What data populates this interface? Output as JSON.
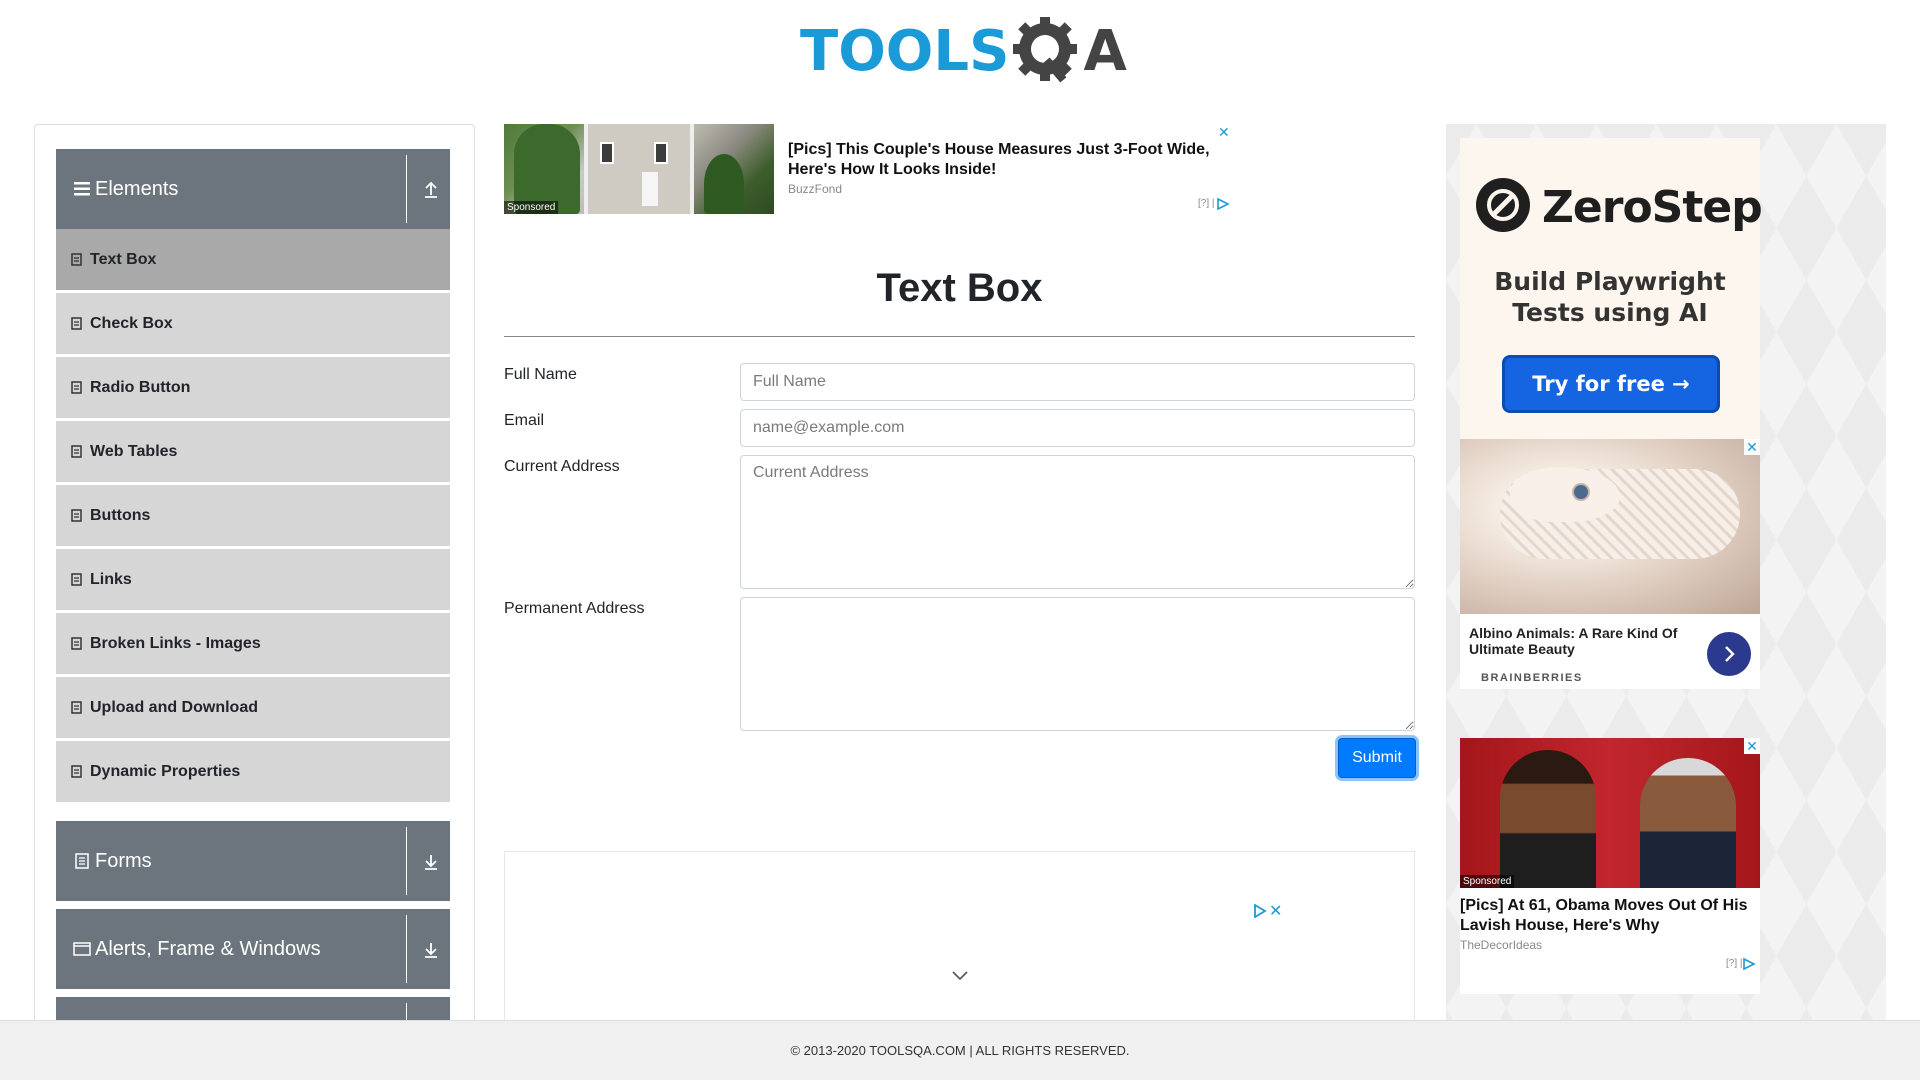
{
  "header": {
    "logo_text_left": "TOOLS",
    "logo_text_right": "A"
  },
  "sidebar": {
    "groups": [
      {
        "label": "Elements",
        "icon": "hamburger-icon",
        "arrow": "collapse-up-icon"
      },
      {
        "label": "Forms",
        "icon": "document-icon",
        "arrow": "expand-down-icon"
      },
      {
        "label": "Alerts, Frame & Windows",
        "icon": "window-icon",
        "arrow": "expand-down-icon"
      }
    ],
    "items": [
      {
        "label": "Text Box",
        "active": true
      },
      {
        "label": "Check Box"
      },
      {
        "label": "Radio Button"
      },
      {
        "label": "Web Tables"
      },
      {
        "label": "Buttons"
      },
      {
        "label": "Links"
      },
      {
        "label": "Broken Links - Images"
      },
      {
        "label": "Upload and Download"
      },
      {
        "label": "Dynamic Properties"
      }
    ]
  },
  "ad_top": {
    "title": "[Pics] This Couple's House Measures Just 3-Foot Wide, Here's How It Looks Inside!",
    "source": "BuzzFond",
    "sponsored": "Sponsored",
    "close": "✕",
    "info": "[?] |"
  },
  "form": {
    "title": "Text Box",
    "full_name_label": "Full Name",
    "full_name_placeholder": "Full Name",
    "email_label": "Email",
    "email_placeholder": "name@example.com",
    "current_address_label": "Current Address",
    "current_address_placeholder": "Current Address",
    "permanent_address_label": "Permanent Address",
    "submit_label": "Submit"
  },
  "ad_bottom": {
    "close": "✕"
  },
  "right_ads": {
    "zerostep": {
      "brand": "ZeroStep",
      "tagline_line1": "Build Playwright",
      "tagline_line2": "Tests using AI",
      "cta": "Try for free →"
    },
    "snake": {
      "title": "Albino Animals: A Rare Kind Of Ultimate Beauty",
      "brand": "BRAINBERRIES",
      "close": "✕"
    },
    "obama": {
      "title": "[Pics] At 61, Obama Moves Out Of His Lavish House, Here's Why",
      "source": "TheDecorIdeas",
      "sponsored": "Sponsored",
      "info": "[?] |",
      "close": "✕"
    }
  },
  "footer": {
    "copyright": "© 2013-2020 TOOLSQA.COM | ALL RIGHTS RESERVED."
  },
  "colors": {
    "brand_blue": "#1a9bd7",
    "sidebar_header": "#6c757d",
    "menu_item": "#d6d6d6",
    "menu_item_active": "#a9a9a9",
    "submit": "#007bff"
  }
}
